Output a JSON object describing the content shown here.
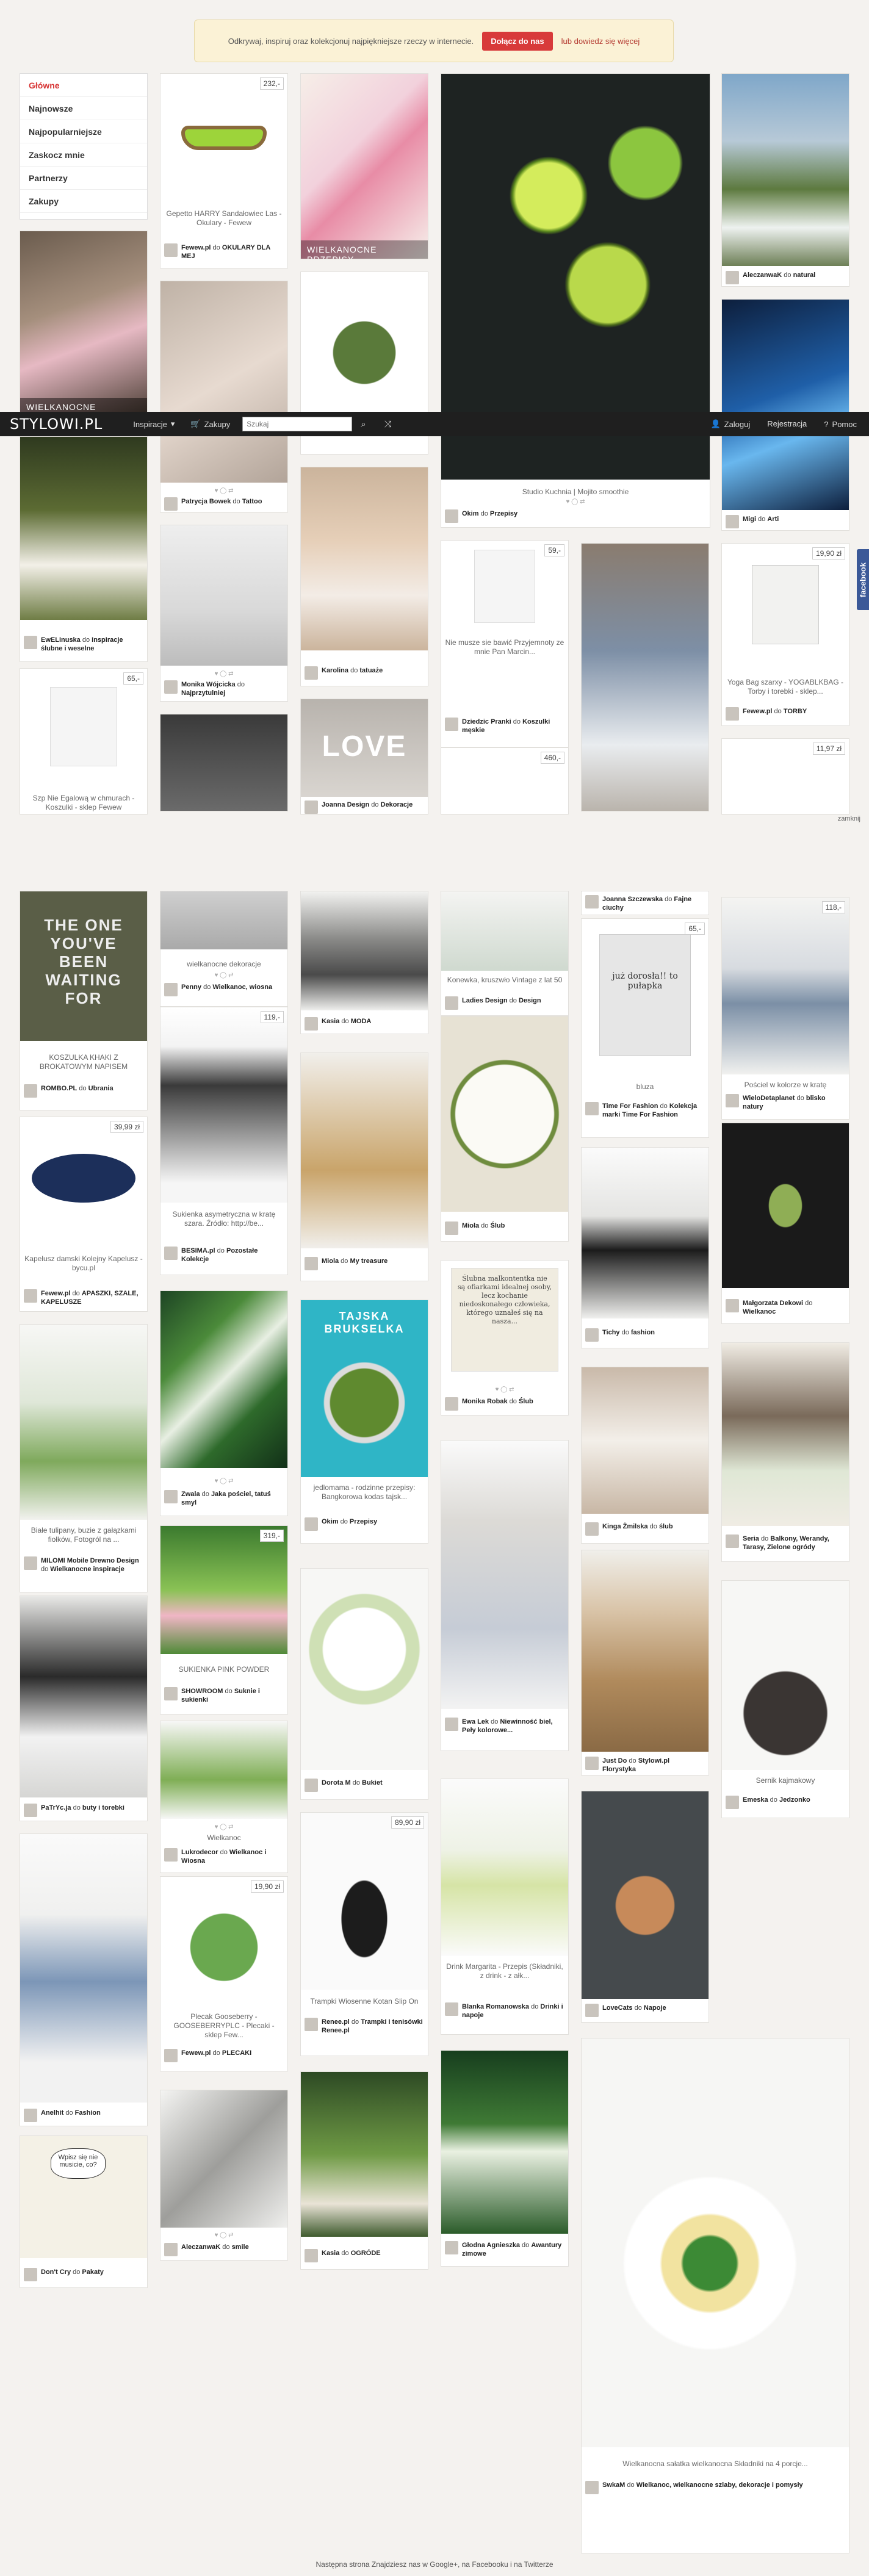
{
  "banner": {
    "text": "Odkrywaj, inspiruj oraz kolekcjonuj najpiękniejsze rzeczy w internecie.",
    "join_button": "Dołącz do nas",
    "more_link": "lub dowiedz się więcej"
  },
  "topbar": {
    "logo": "STYLOWI.PL",
    "inspiracje": "Inspiracje",
    "zakupy": "Zakupy",
    "search_placeholder": "Szukaj",
    "login": "Zaloguj",
    "register": "Rejestracja",
    "help": "Pomoc"
  },
  "menu": {
    "items": [
      "Główne",
      "Najnowsze",
      "Najpopularniejsze",
      "Zaskocz mnie",
      "Partnerzy",
      "Zakupy"
    ]
  },
  "side_tab": "facebook",
  "closebar": "zamknij",
  "cards": {
    "c1_label": "WIELKANOCNE DEKORACJE",
    "c2_price": "232,-",
    "c2_caption": "Gepetto HARRY Sandałowiec Las - Okulary - Fewew",
    "c2_user": "Fewew.pl",
    "c2_board": "OKULARY DLA MEJ",
    "c3_label": "WIELKANOCNE PRZEPISY",
    "c4_caption": "Studio Kuchnia | Mojito smoothie",
    "c4_user": "Okim",
    "c4_board": "Przepisy",
    "c5_user": "AleczanwaK",
    "c5_board": "natural",
    "c6_user": "Patrycja Bowek",
    "c6_board": "Tattoo",
    "c8_user": "Migi",
    "c8_board": "Arti",
    "c9_user": "EwELinuska",
    "c9_board": "Inspiracje ślubne i weselne",
    "c10_user": "Monika Wójcicka",
    "c10_board": "Najprzytulniej",
    "c11_user": "Karolina",
    "c11_board": "tatuaże",
    "c12_price": "59,-",
    "c12_caption": "Nie musze sie bawić Przyjemnoty ze mnie Pan Marcin...",
    "c12_user": "Dziedzic Pranki",
    "c12_board": "Koszulki męskie",
    "c13_price": "19,90 zł",
    "c13_caption": "Yoga Bag szarxy - YOGABLKBAG - Torby i torebki - sklep...",
    "c13_user": "Fewew.pl",
    "c13_board": "TORBY",
    "c14_price": "65,-",
    "c14_caption": "Szp Nie Egalową w chmurach - Koszulki - sklep Fewew",
    "c15_text": "LOVE",
    "c15_user": "Joanna Design",
    "c15_board": "Dekoracje",
    "c16_price": "460,-",
    "c17_price": "11,97 zł",
    "d1_text": "THE ONE YOU'VE BEEN WAITING FOR",
    "d1_caption": "KOSZULKA KHAKI Z BROKATOWYM NAPISEM",
    "d1_user": "ROMBO.PL",
    "d1_board": "Ubrania",
    "d2_caption": "wielkanocne dekoracje",
    "d2_user": "Penny",
    "d2_board": "Wielkanoc, wiosna",
    "d3_user": "Kasia",
    "d3_board": "MODA",
    "d4_caption": "Konewka, kruszwło Vintage z lat 50",
    "d4_user": "Ladies Design",
    "d4_board": "Design",
    "d5_user": "Joanna Szczewska",
    "d5_board": "Fajne ciuchy",
    "d6_price": "65,-",
    "d6_text": "już dorosła!! to pułapka",
    "d6_caption": "bluza",
    "d6_user": "Time For Fashion",
    "d6_board": "Kolekcja marki Time For Fashion",
    "d7_price": "118,-",
    "d7_caption": "Pościel w kolorze w kratę",
    "d7_user": "WieloDetaplanet",
    "d7_board": "blisko natury",
    "d8_price": "119,-",
    "d8_caption": "Sukienka asymetryczna w kratę szara. Źródło: http://be...",
    "d8_user": "BESIMA.pl",
    "d8_board": "Pozostałe Kolekcje",
    "d9_user": "Miola",
    "d9_board": "My treasure",
    "d10_user": "Miola",
    "d10_board": "Ślub",
    "d11_user": "Tichy",
    "d11_board": "fashion",
    "d12_user": "Małgorzata Dekowi",
    "d12_board": "Wielkanoc",
    "d13_price": "39,99 zł",
    "d13_caption": "Kapelusz damski Kolejny Kapelusz - bycu.pl",
    "d13_user": "Fewew.pl",
    "d13_board": "APASZKI, SZALE, KAPELUSZE",
    "d14_text": "TAJSKA BRUKSELKA",
    "d14_caption": "jedlomama - rodzinne przepisy: Bangkorowa kodas tajsk...",
    "d14_user": "Okim",
    "d14_board": "Przepisy",
    "d15_text": "Ślubna malkontentka nie są ofiarkami idealnej osoby, lecz kochanie niedoskonałego człowieka, którego uznałeś się na nasza...",
    "d15_user": "Monika Robak",
    "d15_board": "Ślub",
    "d16_user": "Kinga Żmilska",
    "d16_board": "ślub",
    "d17_user": "Seria",
    "d17_board": "Balkony, Werandy, Tarasy, Zielone ogródy",
    "d18_caption": "Białe tulipany, buzie z gałązkami fiołków, Fotogról na ...",
    "d18_user": "MILOMI Mobile Drewno Design",
    "d18_board": "Wielkanocne inspiracje",
    "d19_user": "Zwala",
    "d19_board": "Jaka pościel, tatuś smyl",
    "d20_price": "319,-",
    "d20_caption": "SUKIENKA PINK POWDER",
    "d20_user": "SHOWROOM",
    "d20_board": "Suknie i sukienki",
    "d21_user": "Dorota M",
    "d21_board": "Bukiet",
    "d22_user": "Ewa Lek",
    "d22_board": "Niewinność biel, Peły kolorowe...",
    "d23_user": "Just Do",
    "d23_board": "Stylowi.pl Florystyka",
    "d24_caption": "Sernik kajmakowy",
    "d24_user": "Emeska",
    "d24_board": "Jedzonko",
    "d25_user": "PaTrYc.ja",
    "d25_board": "buty i torebki",
    "d26_caption": "Wielkanoc",
    "d26_user": "Lukrodecor",
    "d26_board": "Wielkanoc i Wiosna",
    "d27_price": "89,90 zł",
    "d27_caption": "Trampki Wiosenne Kotan Slip On",
    "d27_user": "Renee.pl",
    "d27_board": "Trampki i tenisówki Renee.pl",
    "d28_caption": "Drink Margarita - Przepis (Składniki, z drink - z ałk...",
    "d28_user": "Blanka Romanowska",
    "d28_board": "Drinki i napoje",
    "d29_user": "LoveCats",
    "d29_board": "Napoje",
    "d30_user": "Anelhit",
    "d30_board": "Fashion",
    "d31_price": "19,90 zł",
    "d31_caption": "Plecak Gooseberry - GOOSEBERRYPLC - Plecaki - sklep Few...",
    "d31_user": "Fewew.pl",
    "d31_board": "PLECAKI",
    "d32_text": "Wpisz się nie musicie, co?",
    "d32_user": "Don't Cry",
    "d32_board": "Pakaty",
    "d33_user": "AleczanwaK",
    "d33_board": "smile",
    "d34_user": "Kasia",
    "d34_board": "OGRÓDE",
    "d35_user": "Głodna Agnieszka",
    "d35_board": "Awantury zimowe",
    "d36_caption": "Wielkanocna sałatka wielkanocna Składniki na 4 porcje...",
    "d36_user": "SwkaM",
    "d36_board": "Wielkanoc, wielkanocne szlaby, dekoracje i pomysły"
  },
  "footer": "Następna strona Znajdziesz nas w Google+, na Facebooku i na Twitterze",
  "colors": {
    "accent": "#d83a3a",
    "topbar": "#1f1f1f",
    "banner_bg": "#fbf2d6",
    "page_bg": "#f4f2ef"
  }
}
